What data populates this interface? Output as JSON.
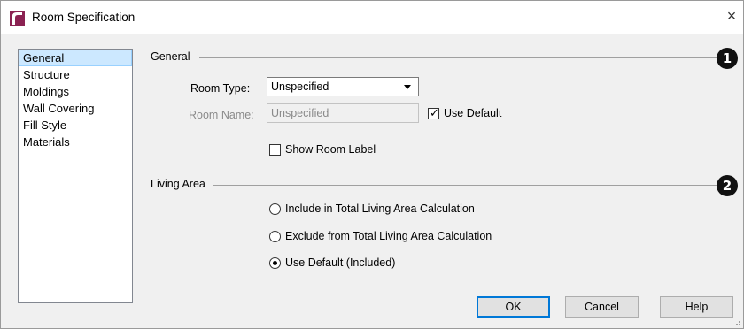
{
  "window": {
    "title": "Room Specification",
    "close_glyph": "×"
  },
  "nav": {
    "items": [
      {
        "label": "General",
        "selected": true
      },
      {
        "label": "Structure",
        "selected": false
      },
      {
        "label": "Moldings",
        "selected": false
      },
      {
        "label": "Wall Covering",
        "selected": false
      },
      {
        "label": "Fill Style",
        "selected": false
      },
      {
        "label": "Materials",
        "selected": false
      }
    ]
  },
  "general": {
    "heading": "General",
    "callout": "1",
    "room_type_label": "Room Type:",
    "room_type_value": "Unspecified",
    "room_name_label": "Room Name:",
    "room_name_value": "Unspecified",
    "use_default_label": "Use Default",
    "use_default_checked": true,
    "show_room_label_label": "Show Room Label",
    "show_room_label_checked": false
  },
  "living_area": {
    "heading": "Living Area",
    "callout": "2",
    "options": [
      {
        "label": "Include in Total Living Area Calculation",
        "selected": false
      },
      {
        "label": "Exclude from Total Living Area Calculation",
        "selected": false
      },
      {
        "label": "Use Default (Included)",
        "selected": true
      }
    ]
  },
  "buttons": {
    "ok": "OK",
    "cancel": "Cancel",
    "help": "Help"
  },
  "colors": {
    "accent": "#0078d7",
    "selection_bg": "#cce8ff",
    "app_icon": "#8b2252"
  },
  "icons": {
    "app": "room-spec-app-icon",
    "close": "close-icon",
    "dropdown": "chevron-down-icon",
    "check": "checkmark-icon"
  }
}
